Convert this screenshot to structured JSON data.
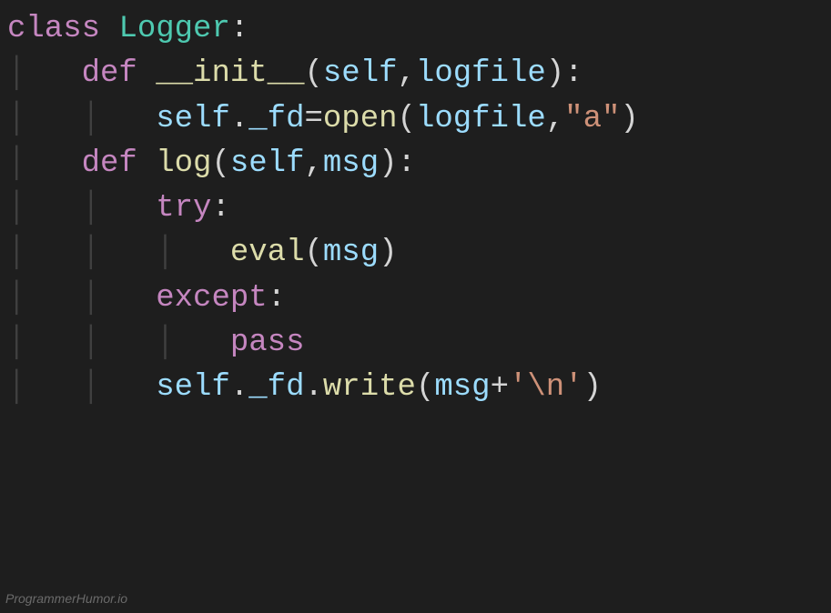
{
  "code": {
    "l1": {
      "kw_class": "class",
      "classname": "Logger",
      "colon": ":"
    },
    "l2": {
      "kw_def": "def",
      "funcname": "__init__",
      "p_open": "(",
      "param_self": "self",
      "comma1": ",",
      "param_logfile": "logfile",
      "p_close": ")",
      "colon": ":"
    },
    "l3": {
      "var_self": "self",
      "dot": ".",
      "prop": "_fd",
      "eq": "=",
      "builtin_open": "open",
      "p_open": "(",
      "arg_logfile": "logfile",
      "comma": ",",
      "string_a": "\"a\"",
      "p_close": ")"
    },
    "l4": {
      "kw_def": "def",
      "funcname": "log",
      "p_open": "(",
      "param_self": "self",
      "comma": ",",
      "param_msg": "msg",
      "p_close": ")",
      "colon": ":"
    },
    "l5": {
      "kw_try": "try",
      "colon": ":"
    },
    "l6": {
      "builtin_eval": "eval",
      "p_open": "(",
      "arg_msg": "msg",
      "p_close": ")"
    },
    "l7": {
      "kw_except": "except",
      "colon": ":"
    },
    "l8": {
      "kw_pass": "pass"
    },
    "l9": {
      "var_self": "self",
      "dot1": ".",
      "prop": "_fd",
      "dot2": ".",
      "method": "write",
      "p_open": "(",
      "arg_msg": "msg",
      "plus": "+",
      "string_nl": "'\\n'",
      "p_close": ")"
    }
  },
  "watermark": "ProgrammerHumor.io",
  "guide_char": "│"
}
